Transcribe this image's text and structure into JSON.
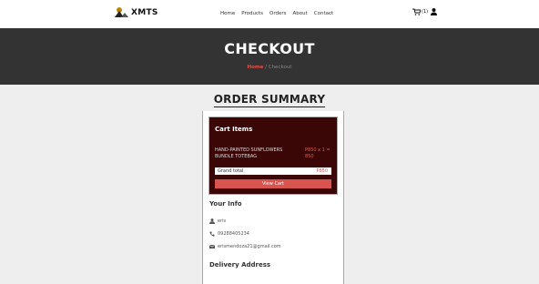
{
  "header": {
    "logo_text": "XMTS",
    "nav": [
      "Home",
      "Products",
      "Orders",
      "About",
      "Contact"
    ],
    "cart_count": "(1)"
  },
  "hero": {
    "title": "CHECKOUT",
    "breadcrumb_home": "Home",
    "breadcrumb_sep": " / ",
    "breadcrumb_current": "Checkout"
  },
  "summary": {
    "title": "ORDER SUMMARY"
  },
  "cart": {
    "title": "Cart Items",
    "item_name": "HAND-PAINTED SUNFLOWERS BUNDLE TOTEBAG",
    "item_price": "P850 x 1 = 850",
    "total_label": "Grand total",
    "total_value": "P850",
    "view_cart_label": "View Cart"
  },
  "your_info": {
    "title": "Your Info",
    "name": "eris",
    "phone": "09288405234",
    "email": "erismendoza21@gmail.com"
  },
  "delivery": {
    "title": "Delivery Address"
  },
  "colors": {
    "accent": "#d9534f",
    "hero_bg": "#333333",
    "cart_bg": "#3a0606"
  }
}
